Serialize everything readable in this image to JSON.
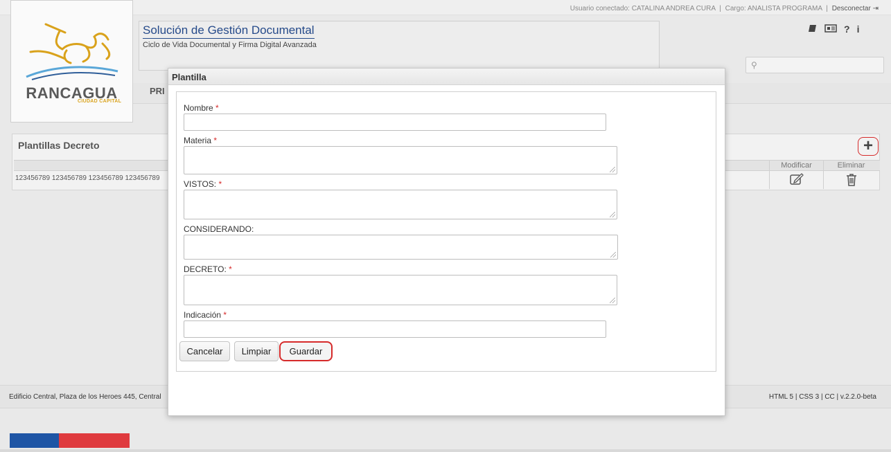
{
  "header": {
    "user_label": "Usuario conectado: CATALINA ANDREA CURA",
    "sep": "|",
    "role_label": "Cargo: ANALISTA PROGRAMA",
    "logout_label": "Desconectar",
    "logo_text": "RANCAGUA",
    "logo_sub": "CIUDAD CAPITAL",
    "app_title": "Solución de Gestión Documental",
    "app_subtitle": "Ciclo de Vida Documental y Firma Digital Avanzada",
    "help_label": "?",
    "info_label": "i",
    "search_placeholder": ""
  },
  "nav": {
    "partial_label": "PRI"
  },
  "panel": {
    "title": "Plantillas Decreto",
    "add_label": "+",
    "col_modify": "Modificar",
    "col_delete": "Eliminar",
    "rows": [
      {
        "name": "123456789 123456789 123456789 123456789"
      }
    ]
  },
  "footer": {
    "address": "Edificio Central, Plaza de los Heroes 445, Central",
    "version": "HTML 5 | CSS 3 | CC | v.2.2.0-beta"
  },
  "modal": {
    "title": "Plantilla",
    "required_mark": "*",
    "fields": {
      "nombre": {
        "label": "Nombre",
        "value": ""
      },
      "materia": {
        "label": "Materia",
        "value": ""
      },
      "vistos": {
        "label": "VISTOS:",
        "value": ""
      },
      "considerando": {
        "label": "CONSIDERANDO:",
        "value": ""
      },
      "decreto": {
        "label": "DECRETO:",
        "value": ""
      },
      "indicacion": {
        "label": "Indicación",
        "value": ""
      }
    },
    "buttons": {
      "cancel": "Cancelar",
      "clear": "Limpiar",
      "save": "Guardar"
    }
  },
  "colors": {
    "accent_red": "#d62a2a",
    "title_blue": "#254a8a",
    "flag_blue": "#1e55a5",
    "flag_red": "#df3a3e"
  }
}
